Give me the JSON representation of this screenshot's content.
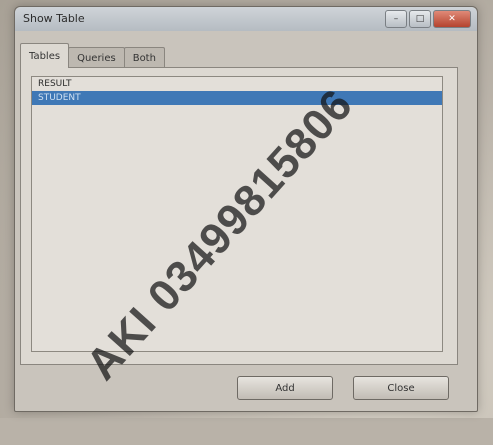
{
  "window": {
    "title": "Show Table",
    "minimize_glyph": "–",
    "maximize_glyph": "□",
    "close_glyph": "✕"
  },
  "tabs": [
    {
      "label": "Tables",
      "active": true
    },
    {
      "label": "Queries",
      "active": false
    },
    {
      "label": "Both",
      "active": false
    }
  ],
  "table_list": [
    {
      "label": "RESULT",
      "selected": false
    },
    {
      "label": "STUDENT",
      "selected": true
    }
  ],
  "buttons": {
    "add_label": "Add",
    "close_label": "Close"
  },
  "watermark": {
    "text": "AKI 03499815806"
  },
  "colors": {
    "selection": "#3f78b6",
    "close_button": "#c0503a"
  }
}
